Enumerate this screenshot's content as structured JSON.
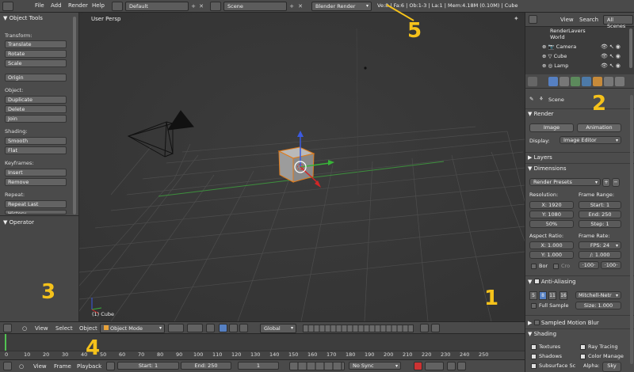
{
  "top_menu": {
    "items": [
      "File",
      "Add",
      "Render",
      "Help"
    ],
    "screen_layout": "Default",
    "scene": "Scene",
    "render_engine": "Blender Render",
    "stats": "Ve:8 | Fa:6 | Ob:1-3 | La:1 | Mem:4.18M (0.10M) | Cube"
  },
  "tool_shelf": {
    "title": "Object Tools",
    "groups": [
      {
        "label": "Transform:",
        "buttons": [
          "Translate",
          "Rotate",
          "Scale"
        ]
      },
      {
        "label": "",
        "buttons": [
          "Origin"
        ]
      },
      {
        "label": "Object:",
        "buttons": [
          "Duplicate",
          "Delete",
          "Join"
        ]
      },
      {
        "label": "Shading:",
        "buttons": [
          "Smooth",
          "Flat"
        ]
      },
      {
        "label": "Keyframes:",
        "buttons": [
          "Insert",
          "Remove"
        ]
      },
      {
        "label": "Repeat:",
        "buttons": [
          "Repeat Last",
          "History..."
        ]
      }
    ],
    "operator_title": "Operator"
  },
  "viewport": {
    "label": "User Persp",
    "object_label": "(1) Cube"
  },
  "view_header": {
    "menus": [
      "View",
      "Select",
      "Object"
    ],
    "mode": "Object Mode",
    "orientation": "Global"
  },
  "timeline": {
    "ticks": [
      "0",
      "10",
      "20",
      "30",
      "40",
      "50",
      "60",
      "70",
      "80",
      "90",
      "100",
      "110",
      "120",
      "130",
      "140",
      "150",
      "160",
      "170",
      "180",
      "190",
      "200",
      "210",
      "220",
      "230",
      "240",
      "250"
    ],
    "menus": [
      "View",
      "Frame",
      "Playback"
    ],
    "start": "Start: 1",
    "end": "End: 250",
    "current": "1",
    "sync": "No Sync"
  },
  "outliner": {
    "view": "View",
    "search": "Search",
    "filter": "All Scenes",
    "rows": [
      "RenderLayers",
      "World",
      "Camera",
      "Cube",
      "Lamp"
    ]
  },
  "properties": {
    "scene_label": "Scene",
    "render_header": "Render",
    "image_btn": "Image",
    "animation_btn": "Animation",
    "display_label": "Display:",
    "display_value": "Image Editor",
    "layers_header": "Layers",
    "dimensions_header": "Dimensions",
    "render_presets": "Render Presets",
    "resolution_label": "Resolution:",
    "res_x": "X: 1920",
    "res_y": "Y: 1080",
    "res_pct": "50%",
    "frame_range_label": "Frame Range:",
    "start": "Start: 1",
    "end": "End: 250",
    "step": "Step: 1",
    "aspect_label": "Aspect Ratio:",
    "aspect_x": "X: 1.000",
    "aspect_y": "Y: 1.000",
    "frame_rate_label": "Frame Rate:",
    "fps": "FPS: 24",
    "fps_base": "/: 1.000",
    "bor": "Bor",
    "cro": "Cro",
    "map_old": "·100·",
    "map_new": "·100·",
    "aa_header": "Anti-Aliasing",
    "aa_samples": [
      "5",
      "8",
      "11",
      "16"
    ],
    "aa_filter": "Mitchell-Netr",
    "full_sample": "Full Sample",
    "aa_size": "Size: 1.000",
    "motion_blur_header": "Sampled Motion Blur",
    "shading_header": "Shading",
    "textures": "Textures",
    "ray_tracing": "Ray Tracing",
    "shadows": "Shadows",
    "color_manage": "Color Manage",
    "subsurface": "Subsurface Sc",
    "alpha_label": "Alpha:",
    "alpha_value": "Sky"
  },
  "callouts": {
    "one": "1",
    "two": "2",
    "three": "3",
    "four": "4",
    "five": "5"
  }
}
